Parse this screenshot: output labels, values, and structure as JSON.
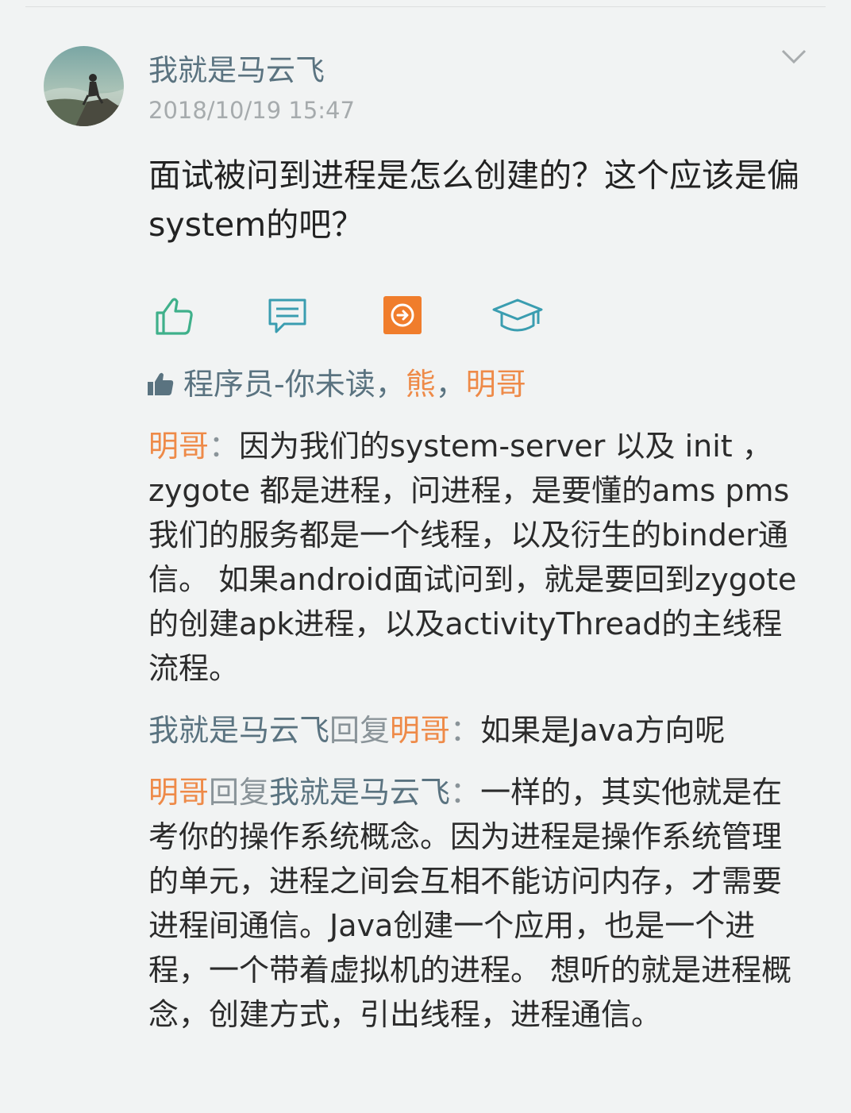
{
  "post": {
    "author": "我就是马云飞",
    "time": "2018/10/19 15:47",
    "text": "面试被问到进程是怎么创建的？这个应该是偏system的吧？"
  },
  "actions": {
    "like_icon": "thumbs-up-icon",
    "comment_icon": "comment-icon",
    "share_icon": "share-icon",
    "learn_icon": "graduation-cap-icon"
  },
  "likes": {
    "users": [
      "程序员-你未读",
      "熊",
      "明哥"
    ],
    "sep": "，"
  },
  "comments": [
    {
      "author": "明哥",
      "colon": "：",
      "text": "因为我们的system-server  以及 init  ，zygote  都是进程，问进程，是要懂的ams  pms  我们的服务都是一个线程，以及衍生的binder通信。 如果android面试问到，就是要回到zygote的创建apk进程，以及activityThread的主线程流程。"
    },
    {
      "author": "我就是马云飞",
      "reply_word": "回复",
      "reply_to": "明哥",
      "colon": "：",
      "text": "如果是Java方向呢"
    },
    {
      "author": "明哥",
      "reply_word": "回复",
      "reply_to": "我就是马云飞",
      "colon": "：",
      "text": "一样的，其实他就是在考你的操作系统概念。因为进程是操作系统管理的单元，进程之间会互相不能访问内存，才需要进程间通信。Java创建一个应用，也是一个进程，一个带着虚拟机的进程。 想听的就是进程概念，创建方式，引出线程，进程通信。"
    }
  ],
  "colors": {
    "green": "#3fb08a",
    "teal": "#3a9db0",
    "orange": "#ee8a48",
    "name_blue": "#5a7380"
  }
}
